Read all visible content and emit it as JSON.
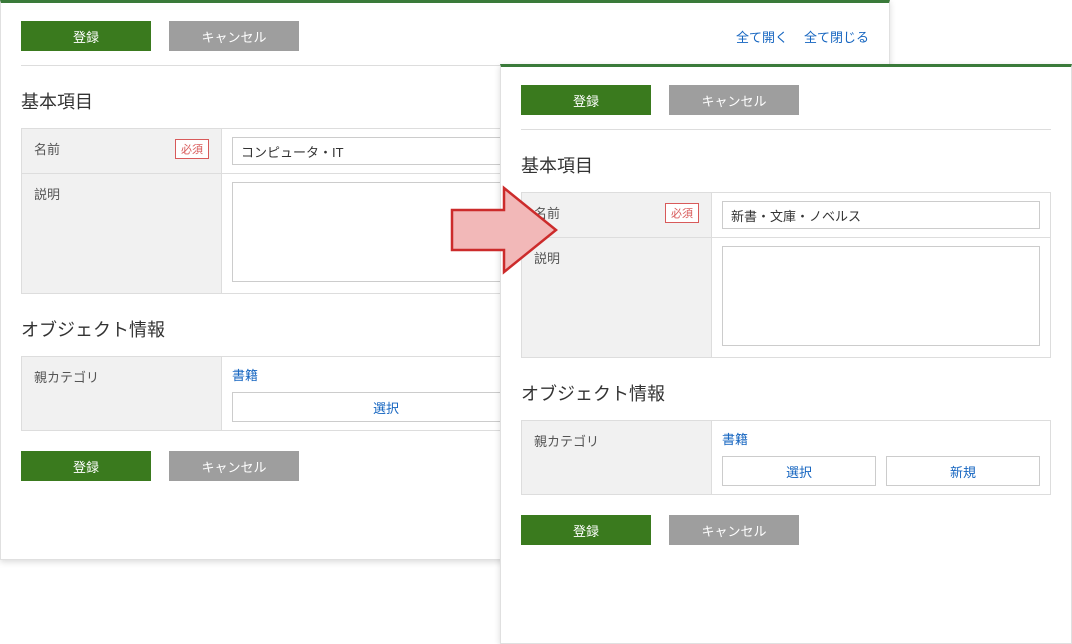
{
  "common": {
    "register_label": "登録",
    "cancel_label": "キャンセル",
    "expand_all": "全て開く",
    "collapse_all": "全て閉じる",
    "section_basic": "基本項目",
    "section_object": "オブジェクト情報",
    "label_name": "名前",
    "label_required": "必須",
    "label_description": "説明",
    "label_parent_category": "親カテゴリ",
    "select_label": "選択",
    "new_label": "新規"
  },
  "left": {
    "name_value": "コンピュータ・IT",
    "description_value": "",
    "parent_category_value": "書籍"
  },
  "right": {
    "name_value": "新書・文庫・ノベルス",
    "description_value": "",
    "parent_category_value": "書籍"
  }
}
